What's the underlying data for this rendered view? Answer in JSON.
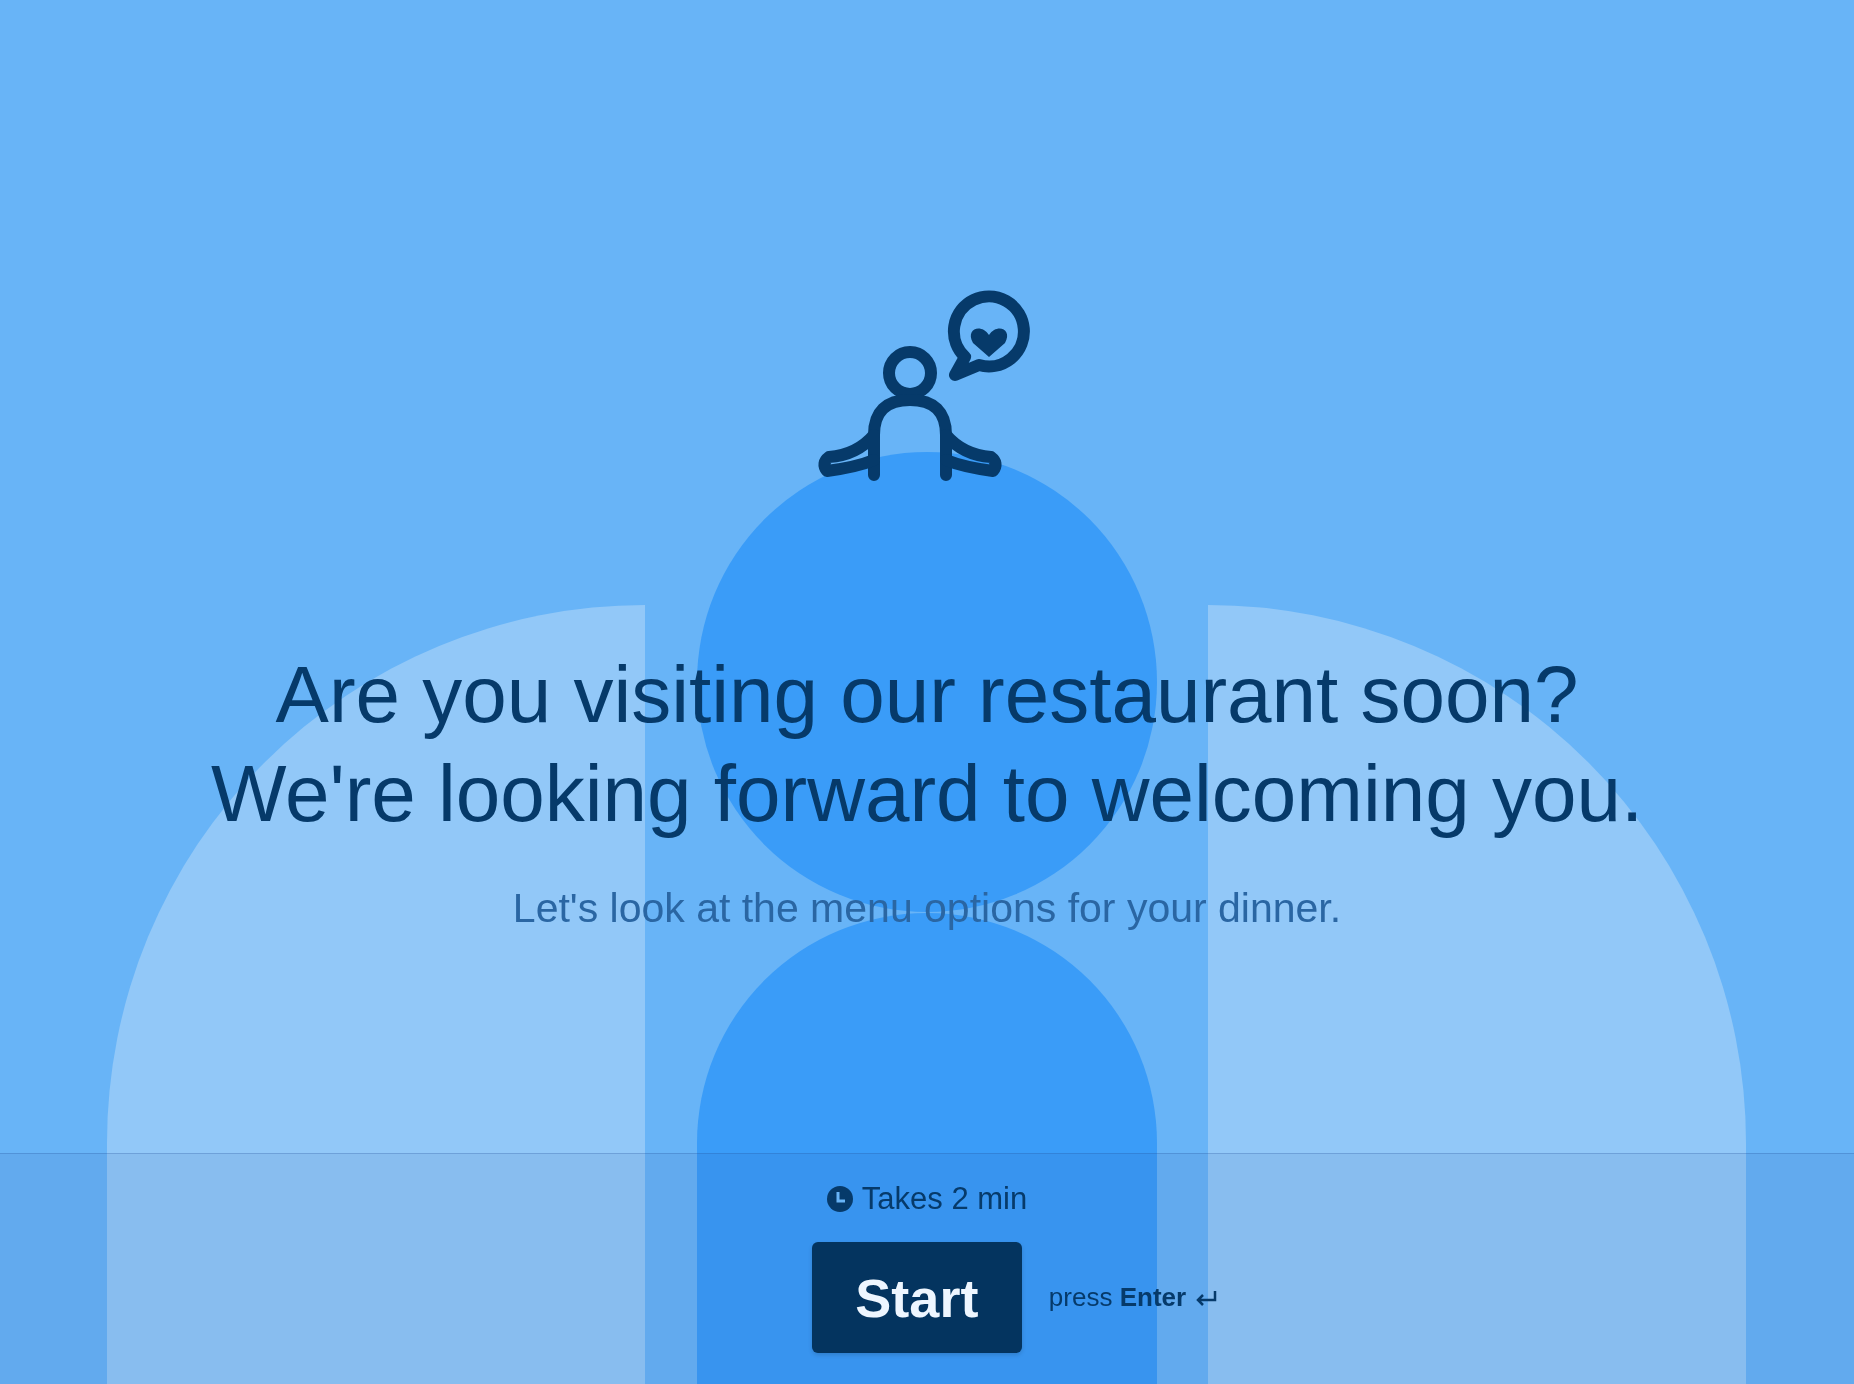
{
  "welcome": {
    "heading_lines": [
      "Are you visiting our restaurant soon?",
      "We're looking forward to welcoming you."
    ],
    "subtitle": "Let's look at the menu options for your dinner."
  },
  "footer": {
    "duration": "Takes 2 min",
    "start_button": "Start",
    "hint": "press **Enter**"
  }
}
